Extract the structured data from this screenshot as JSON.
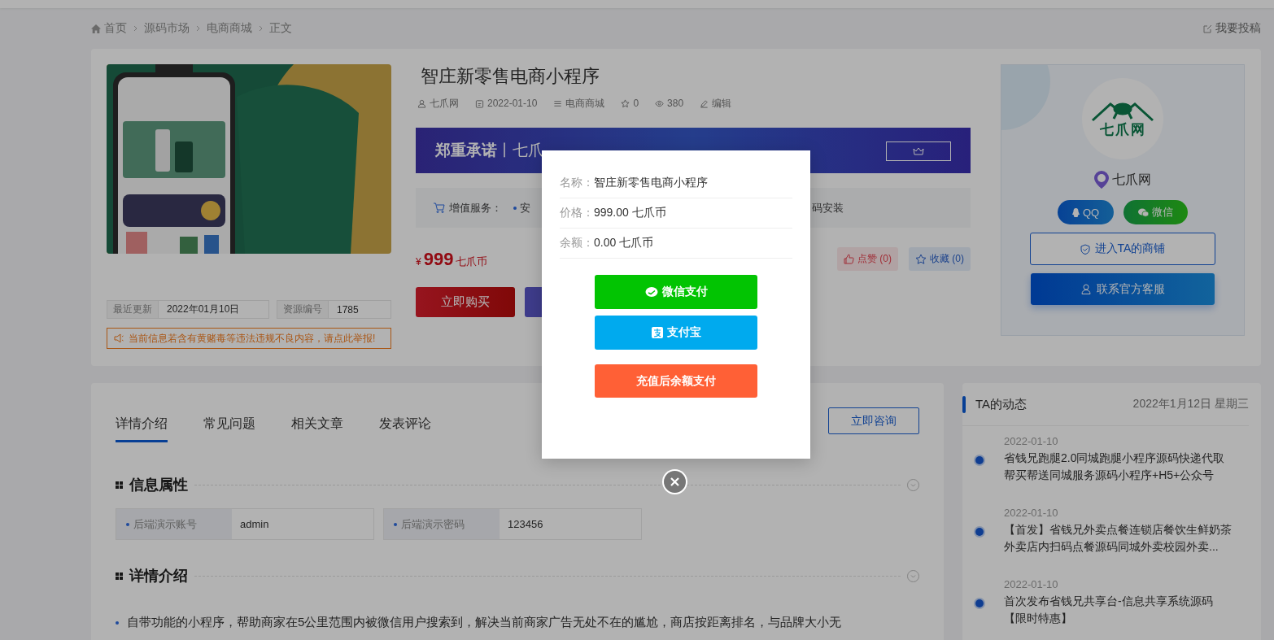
{
  "breadcrumb": [
    {
      "label": "首页"
    },
    {
      "label": "源码市场"
    },
    {
      "label": "电商商城"
    },
    {
      "label": "正文"
    }
  ],
  "contribute": "我要投稿",
  "product": {
    "info": [
      {
        "label": "最近更新",
        "value": "2022年01月10日"
      },
      {
        "label": "资源编号",
        "value": "1785"
      }
    ],
    "report": "当前信息若含有黄赌毒等违法违规不良内容，请点此举报!",
    "title": "智庄新零售电商小程序",
    "meta": [
      {
        "kind": "author",
        "text": "七爪网"
      },
      {
        "kind": "date",
        "text": "2022-01-10"
      },
      {
        "kind": "category",
        "text": "电商商城"
      },
      {
        "kind": "stars",
        "text": "0"
      },
      {
        "kind": "views",
        "text": "380"
      },
      {
        "kind": "edit",
        "text": "编辑"
      }
    ],
    "banner": {
      "bold": "郑重承诺",
      "text": "丨七爪"
    },
    "services": {
      "label": "增值服务：",
      "items": [
        "安",
        "码安装"
      ]
    },
    "price": {
      "currency": "¥",
      "amount": "999",
      "unit": "七爪币"
    },
    "buy": "立即购买",
    "actions": [
      {
        "kind": "like",
        "label": "点赞 (0)"
      },
      {
        "kind": "favorite",
        "label": "收藏 (0)"
      }
    ]
  },
  "seller": {
    "logo_text": "七爪网",
    "name": "七爪网",
    "contacts": [
      {
        "kind": "qq",
        "label": "QQ"
      },
      {
        "kind": "wechat",
        "label": "微信"
      }
    ],
    "shop": "进入TA的商铺",
    "service": "联系官方客服"
  },
  "details": {
    "tabs": [
      {
        "label": "详情介绍",
        "selected": true
      },
      {
        "label": "常见问题",
        "selected": false
      },
      {
        "label": "相关文章",
        "selected": false
      },
      {
        "label": "发表评论",
        "selected": false
      }
    ],
    "consult": "立即咨询",
    "attributes": {
      "title": "信息属性",
      "fields": [
        {
          "label": "后端演示账号",
          "value": "admin"
        },
        {
          "label": "后端演示密码",
          "value": "123456"
        }
      ]
    },
    "intro": {
      "title": "详情介绍",
      "paragraph": "自带功能的小程序，帮助商家在5公里范围内被微信用户搜索到，解决当前商家广告无处不在的尴尬，商店按距离排名，与品牌大小无"
    }
  },
  "feed": {
    "title": "TA的动态",
    "date": "2022年1月12日 星期三",
    "items": [
      {
        "date": "2022-01-10",
        "text": "省钱兄跑腿2.0同城跑腿小程序源码快递代取帮买帮送同城服务源码小程序+H5+公众号"
      },
      {
        "date": "2022-01-10",
        "text": "【首发】省钱兄外卖点餐连锁店餐饮生鲜奶茶外卖店内扫码点餐源码同城外卖校园外卖..."
      },
      {
        "date": "2022-01-10",
        "text": "首次发布省钱兄共享台-信息共享系统源码【限时特惠】"
      }
    ]
  },
  "modal": {
    "rows": [
      {
        "label": "名称：",
        "value": "智庄新零售电商小程序"
      },
      {
        "label": "价格：",
        "value": "999.00 七爪币"
      },
      {
        "label": "余额：",
        "value": "0.00 七爪币"
      }
    ],
    "buttons": [
      {
        "kind": "wechat",
        "label": "微信支付"
      },
      {
        "kind": "alipay",
        "label": "支付宝"
      },
      {
        "kind": "balance",
        "label": "充值后余额支付"
      }
    ]
  }
}
